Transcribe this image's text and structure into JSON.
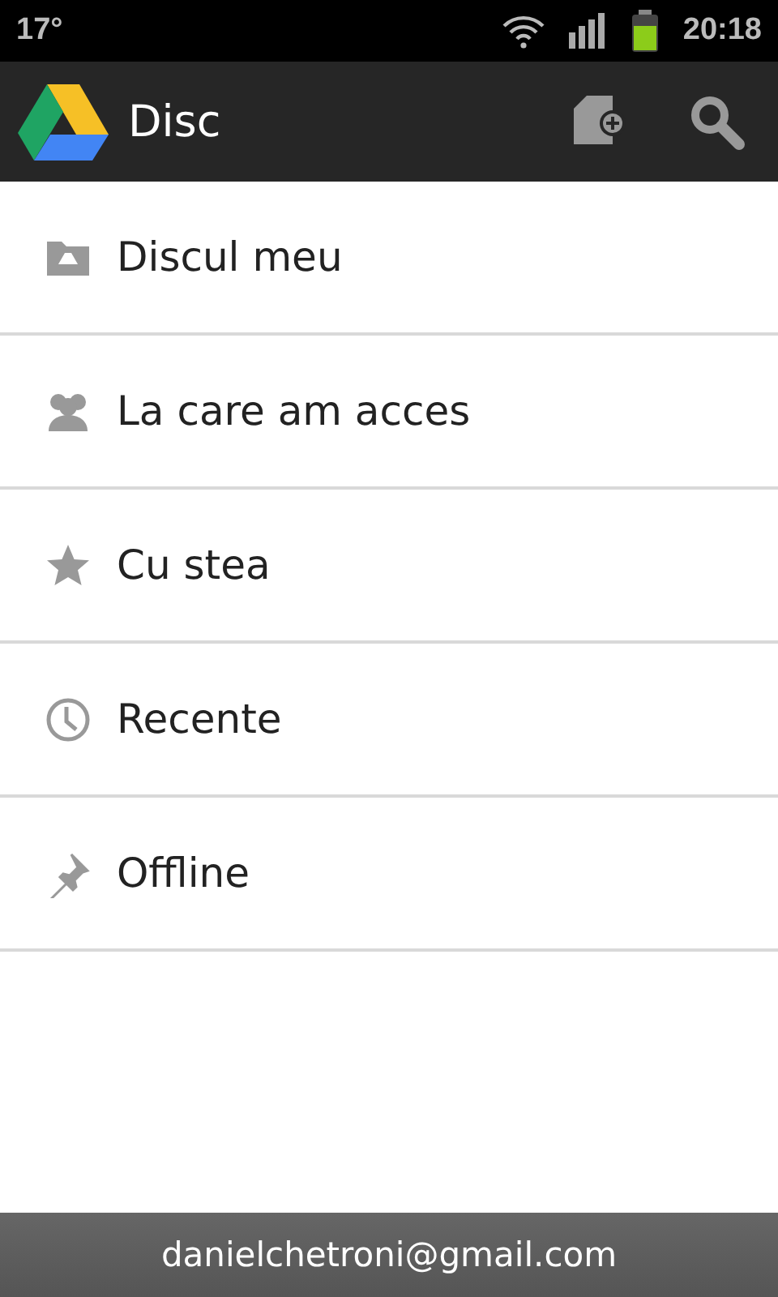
{
  "status_bar": {
    "temperature": "17°",
    "time": "20:18"
  },
  "action_bar": {
    "title": "Disc"
  },
  "items": [
    {
      "kind": "drive",
      "label": "Discul meu"
    },
    {
      "kind": "people",
      "label": "La care am acces"
    },
    {
      "kind": "star",
      "label": "Cu stea"
    },
    {
      "kind": "clock",
      "label": "Recente"
    },
    {
      "kind": "pin",
      "label": "Offline"
    }
  ],
  "footer": {
    "account": "danielchetroni@gmail.com"
  }
}
